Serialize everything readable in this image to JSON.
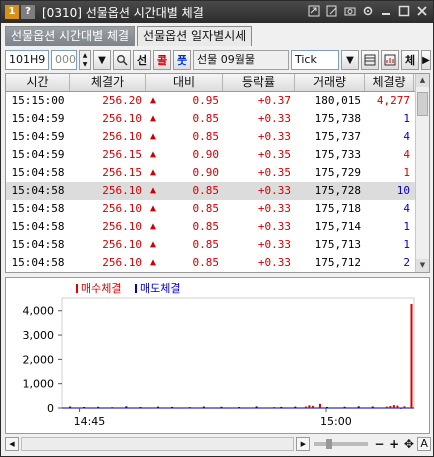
{
  "window": {
    "badge_number": "1",
    "badge_help": "?",
    "title": "[0310] 선물옵션 시간대별 체결"
  },
  "tabs": [
    {
      "label": "선물옵션 시간대별 체결",
      "active": true
    },
    {
      "label": "선물옵션 일자별시세",
      "active": false
    }
  ],
  "toolbar": {
    "code": "101H9",
    "count": "000",
    "btn_select": "선",
    "btn_call": "콜",
    "btn_put": "풋",
    "instrument": "선물 09월물",
    "interval": "Tick",
    "btn_trade": "체"
  },
  "table": {
    "headers": [
      "시간",
      "체결가",
      "대비",
      "등락률",
      "거래량",
      "체결량"
    ],
    "arrow_symbol": "▲",
    "selected_row": 5,
    "rows": [
      {
        "time": "15:15:00",
        "price": "256.20",
        "diff": "0.95",
        "rate": "+0.37",
        "volume": "180,015",
        "qty": "4,277",
        "side": "buy"
      },
      {
        "time": "15:04:59",
        "price": "256.10",
        "diff": "0.85",
        "rate": "+0.33",
        "volume": "175,738",
        "qty": "1",
        "side": "sell"
      },
      {
        "time": "15:04:59",
        "price": "256.10",
        "diff": "0.85",
        "rate": "+0.33",
        "volume": "175,737",
        "qty": "4",
        "side": "sell"
      },
      {
        "time": "15:04:59",
        "price": "256.15",
        "diff": "0.90",
        "rate": "+0.35",
        "volume": "175,733",
        "qty": "4",
        "side": "buy"
      },
      {
        "time": "15:04:58",
        "price": "256.15",
        "diff": "0.90",
        "rate": "+0.35",
        "volume": "175,729",
        "qty": "1",
        "side": "buy"
      },
      {
        "time": "15:04:58",
        "price": "256.10",
        "diff": "0.85",
        "rate": "+0.33",
        "volume": "175,728",
        "qty": "10",
        "side": "sell"
      },
      {
        "time": "15:04:58",
        "price": "256.10",
        "diff": "0.85",
        "rate": "+0.33",
        "volume": "175,718",
        "qty": "4",
        "side": "sell"
      },
      {
        "time": "15:04:58",
        "price": "256.10",
        "diff": "0.85",
        "rate": "+0.33",
        "volume": "175,714",
        "qty": "1",
        "side": "sell"
      },
      {
        "time": "15:04:58",
        "price": "256.10",
        "diff": "0.85",
        "rate": "+0.33",
        "volume": "175,713",
        "qty": "1",
        "side": "sell"
      },
      {
        "time": "15:04:58",
        "price": "256.10",
        "diff": "0.85",
        "rate": "+0.33",
        "volume": "175,712",
        "qty": "2",
        "side": "sell"
      }
    ]
  },
  "colors": {
    "up_red": "#d10000",
    "sell_blue": "#0000cc",
    "buy_red": "#e00000"
  },
  "chart_data": {
    "type": "bar",
    "legend": [
      "매수체결",
      "매도체결"
    ],
    "legend_placement": "top-left",
    "y_ticks": [
      "4,000",
      "3,000",
      "2,000",
      "1,000",
      "0"
    ],
    "x_ticks": [
      "14:45",
      "15:00"
    ],
    "ylim": [
      0,
      4277
    ],
    "xlim": [
      0,
      100
    ],
    "series": [
      {
        "name": "매수체결",
        "x": [
          60,
          69,
          70,
          71,
          73,
          92,
          93,
          94,
          95,
          97,
          99
        ],
        "values": [
          40,
          60,
          110,
          90,
          170,
          55,
          80,
          120,
          100,
          70,
          4277
        ]
      },
      {
        "name": "매도체결",
        "x": [
          2,
          6,
          10,
          14,
          18,
          22,
          27,
          31,
          36,
          40,
          45,
          50,
          55,
          62,
          66,
          75,
          80,
          84,
          88,
          96
        ],
        "values": [
          60,
          40,
          50,
          30,
          70,
          40,
          55,
          45,
          35,
          60,
          50,
          40,
          65,
          45,
          55,
          40,
          50,
          70,
          60,
          10
        ]
      }
    ]
  }
}
